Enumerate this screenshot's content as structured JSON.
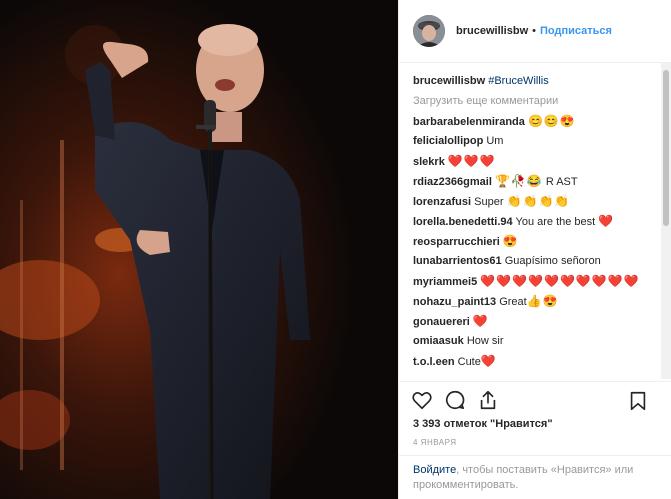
{
  "header": {
    "username": "brucewillisbw",
    "separator": "•",
    "follow_label": "Подписаться"
  },
  "caption": {
    "username": "brucewillisbw",
    "hashtag": "#BruceWillis"
  },
  "load_more_label": "Загрузить еще комментарии",
  "comments": [
    {
      "user": "barbarabelenmiranda",
      "text": "",
      "emoji": "😊😊😍"
    },
    {
      "user": "felicialollipop",
      "text": "Um",
      "emoji": ""
    },
    {
      "user": "slekrk",
      "text": "",
      "emoji": "❤️❤️❤️"
    },
    {
      "user": "rdiaz2366gmail",
      "text": "R AST",
      "emoji": "🏆🥀😂"
    },
    {
      "user": "lorenzafusi",
      "text": "Super",
      "emoji": "👏👏👏👏"
    },
    {
      "user": "lorella.benedetti.94",
      "text": "You are the best",
      "emoji": "❤️"
    },
    {
      "user": "reosparrucchieri",
      "text": "",
      "emoji": "😍"
    },
    {
      "user": "lunabarrientos61",
      "text": "Guapísimo señoron",
      "emoji": ""
    },
    {
      "user": "myriammei5",
      "text": "",
      "emoji": "❤️❤️❤️❤️❤️❤️❤️❤️❤️❤️"
    },
    {
      "user": "nohazu_paint13",
      "text": "Great",
      "emoji": "👍😍"
    },
    {
      "user": "gonauereri",
      "text": "",
      "emoji": "❤️"
    },
    {
      "user": "omiaasuk",
      "text": "How sir",
      "emoji": ""
    },
    {
      "user": "t.o.l.een",
      "text": "Cute",
      "emoji": "❤️"
    }
  ],
  "likes_text": "3 393 отметок \"Нравится\"",
  "date_text": "4 ЯНВАРЯ",
  "login": {
    "link": "Войдите",
    "rest": ", чтобы поставить «Нравится» или прокомментировать."
  },
  "icons": {
    "like": "heart-outline-icon",
    "comment": "speech-bubble-icon",
    "share": "share-icon",
    "save": "bookmark-icon"
  },
  "colors": {
    "link_blue": "#3897f0",
    "dark_link": "#003569",
    "heart_red": "#ed4956",
    "muted_text": "#999999"
  }
}
